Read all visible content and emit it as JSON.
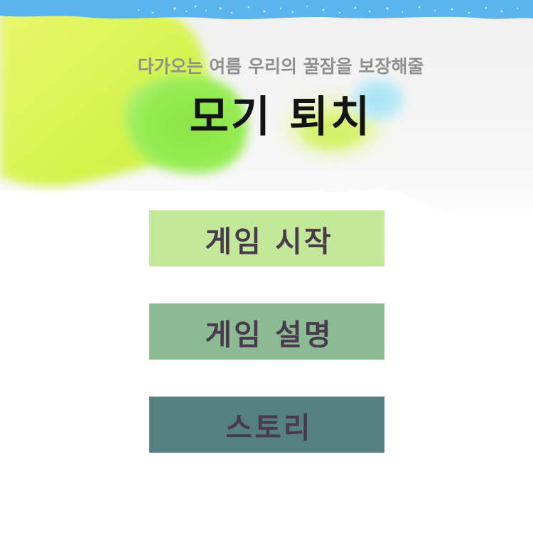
{
  "header": {
    "subtitle": "다가오는 여름 우리의 꿀잠을 보장해줄",
    "title": "모기 퇴치"
  },
  "menu": {
    "start_label": "게임 시작",
    "guide_label": "게임 설명",
    "story_label": "스토리"
  },
  "colors": {
    "start_button": "#c4e899",
    "guide_button": "#8cbb93",
    "story_button": "#54817f",
    "button_text": "#4a3a4e",
    "title_text": "#141414",
    "subtitle_text": "#8f8f8f",
    "sky_stripe": "#5ab4ee",
    "yellow_splash": "#d9f25a",
    "green_splash": "#8ce94c",
    "blue_splash": "#a9e4f3"
  }
}
